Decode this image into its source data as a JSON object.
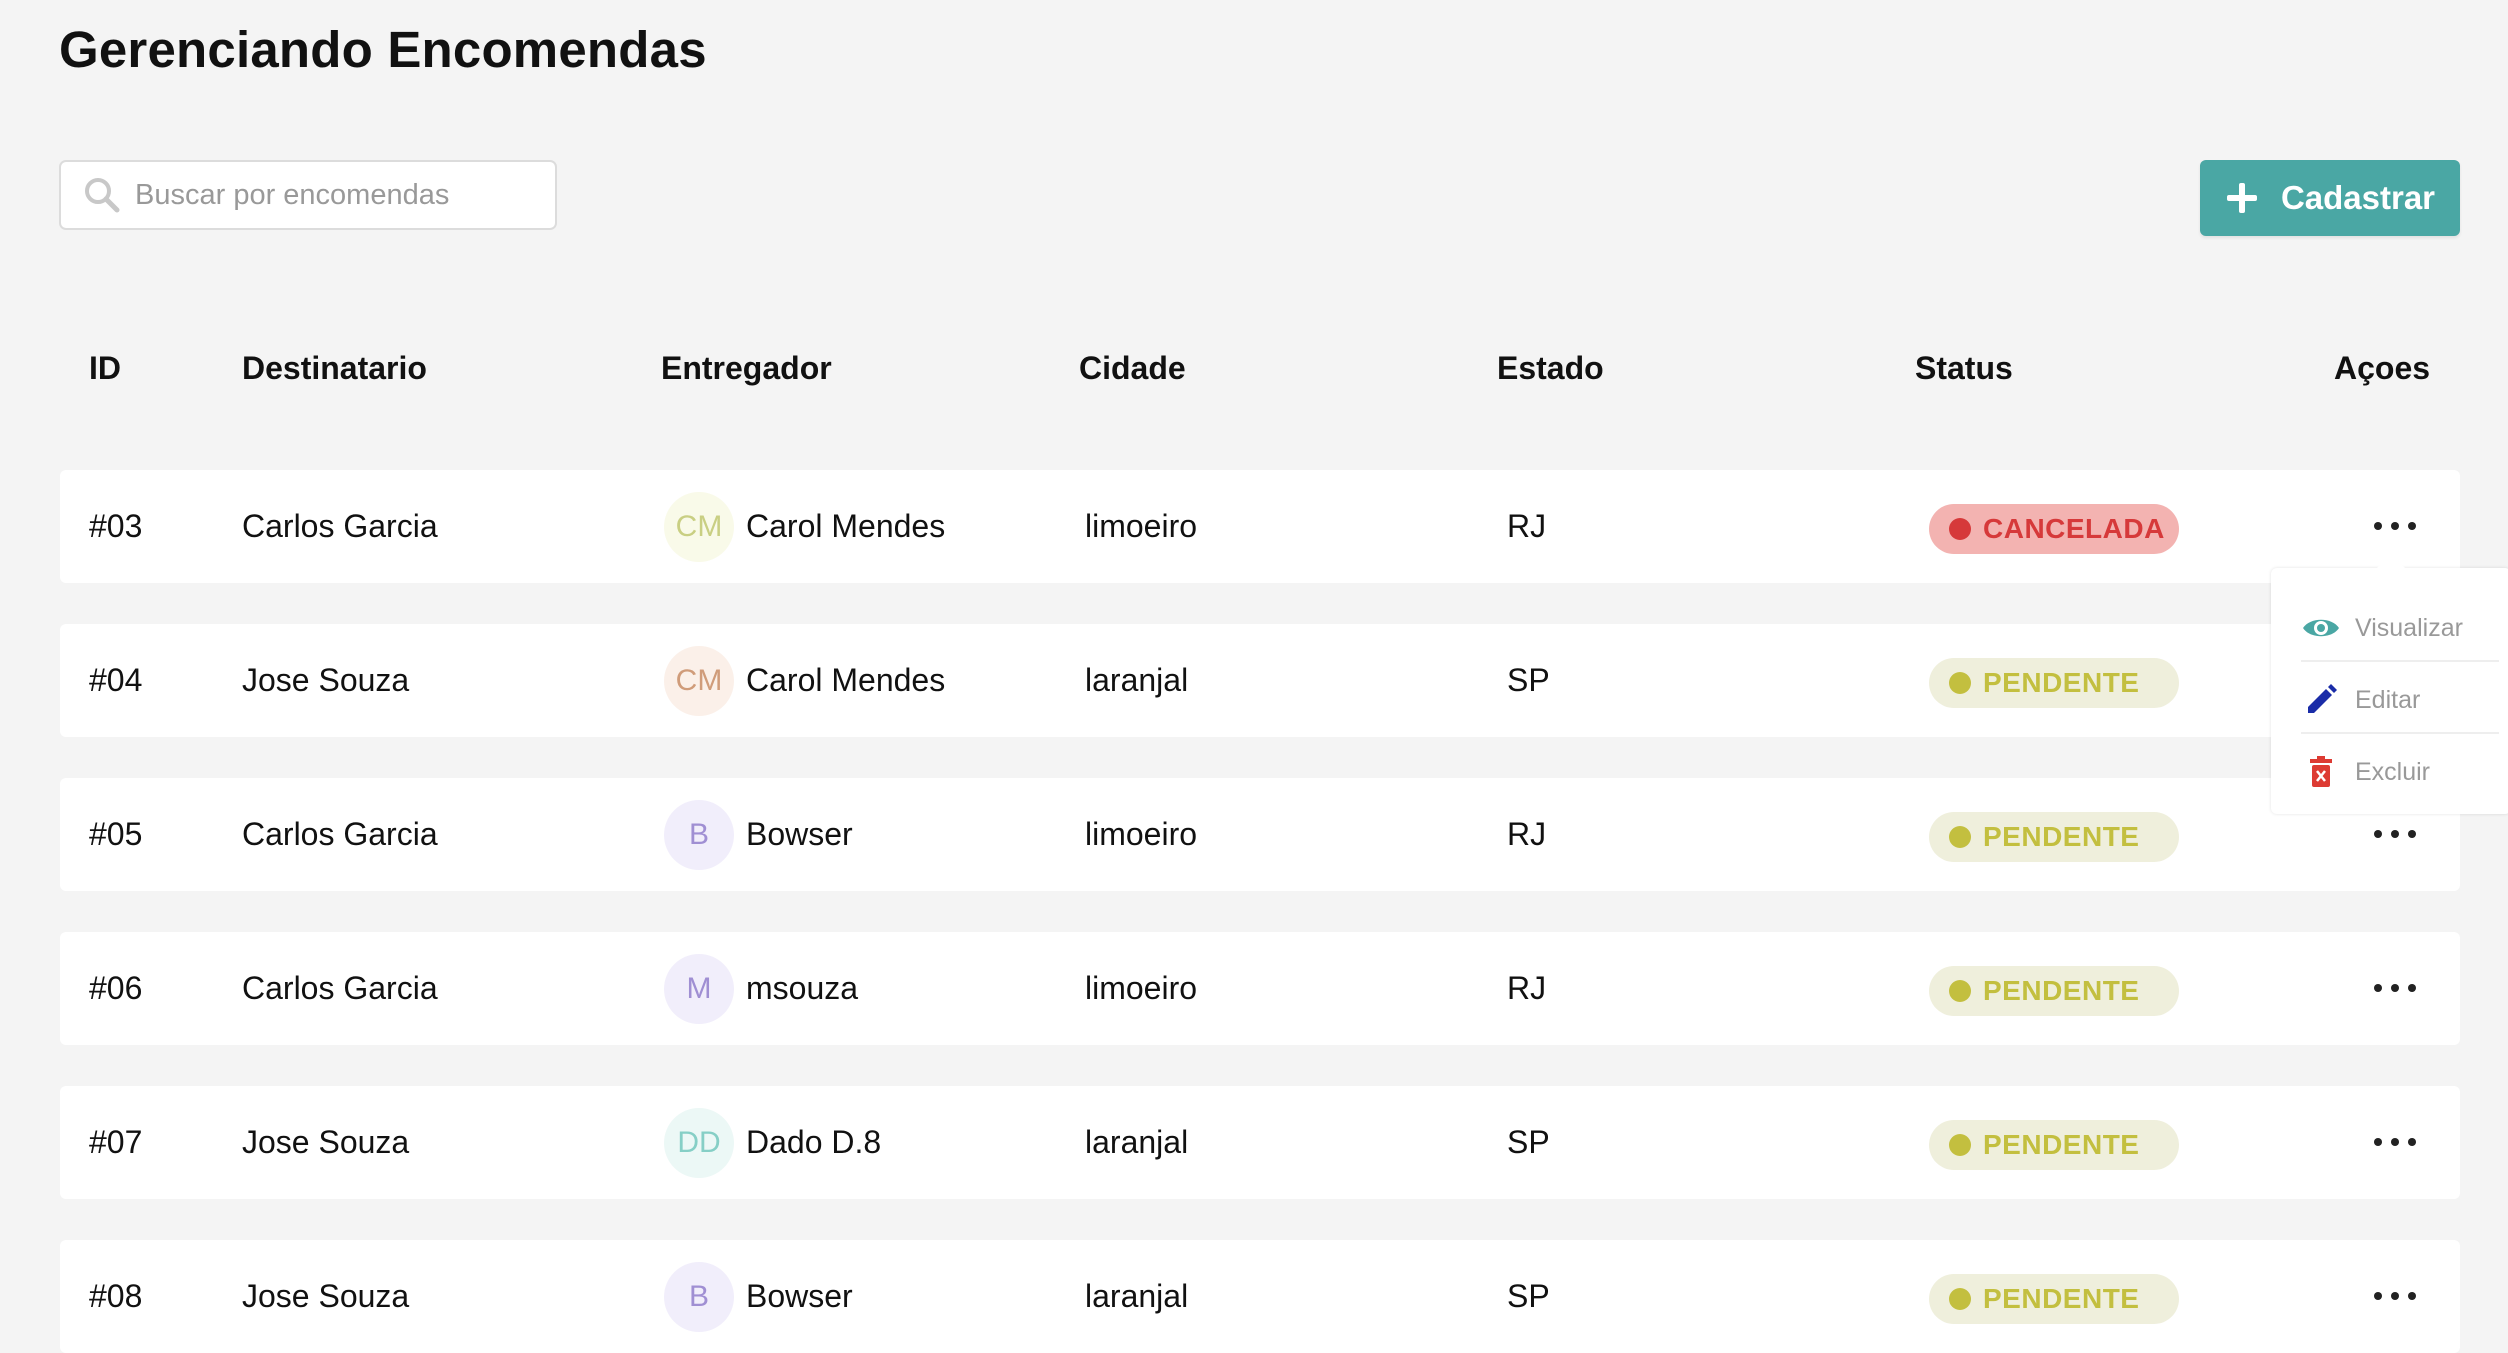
{
  "page": {
    "title": "Gerenciando Encomendas"
  },
  "search": {
    "placeholder": "Buscar por encomendas",
    "value": ""
  },
  "toolbar": {
    "add_label": "Cadastrar"
  },
  "table": {
    "headers": [
      "ID",
      "Destinatario",
      "Entregador",
      "Cidade",
      "Estado",
      "Status",
      "Açoes"
    ],
    "rows": [
      {
        "id": "#03",
        "recipient": "Carlos Garcia",
        "deliveryman": {
          "initials": "CM",
          "name": "Carol Mendes",
          "color": "#c9cf83",
          "bg": "#f9fae9"
        },
        "city": "limoeiro",
        "state": "RJ",
        "status": "CANCELADA"
      },
      {
        "id": "#04",
        "recipient": "Jose Souza",
        "deliveryman": {
          "initials": "CM",
          "name": "Carol Mendes",
          "color": "#d09c7a",
          "bg": "#fbf0e9"
        },
        "city": "laranjal",
        "state": "SP",
        "status": "PENDENTE"
      },
      {
        "id": "#05",
        "recipient": "Carlos Garcia",
        "deliveryman": {
          "initials": "B",
          "name": "Bowser",
          "color": "#a08fd3",
          "bg": "#f1eefb"
        },
        "city": "limoeiro",
        "state": "RJ",
        "status": "PENDENTE"
      },
      {
        "id": "#06",
        "recipient": "Carlos Garcia",
        "deliveryman": {
          "initials": "M",
          "name": "msouza",
          "color": "#a08fd3",
          "bg": "#f1eefb"
        },
        "city": "limoeiro",
        "state": "RJ",
        "status": "PENDENTE"
      },
      {
        "id": "#07",
        "recipient": "Jose Souza",
        "deliveryman": {
          "initials": "DD",
          "name": "Dado D.8",
          "color": "#86cfc6",
          "bg": "#ecf8f6"
        },
        "city": "laranjal",
        "state": "SP",
        "status": "PENDENTE"
      },
      {
        "id": "#08",
        "recipient": "Jose Souza",
        "deliveryman": {
          "initials": "B",
          "name": "Bowser",
          "color": "#a08fd3",
          "bg": "#f1eefb"
        },
        "city": "laranjal",
        "state": "SP",
        "status": "PENDENTE"
      }
    ]
  },
  "status_styles": {
    "CANCELADA": {
      "bg": "#f3b3b1",
      "color": "#d6393a"
    },
    "PENDENTE": {
      "bg": "#efefdc",
      "color": "#c3bf3f"
    }
  },
  "row_menu": {
    "items": [
      {
        "label": "Visualizar",
        "icon": "eye-icon",
        "color": "#4aa7a4"
      },
      {
        "label": "Editar",
        "icon": "pencil-icon",
        "color": "#1a2ca8"
      },
      {
        "label": "Excluir",
        "icon": "trash-icon",
        "color": "#dd3b33"
      }
    ]
  },
  "colors": {
    "accent": "#4aa7a4",
    "background": "#f4f4f4"
  }
}
